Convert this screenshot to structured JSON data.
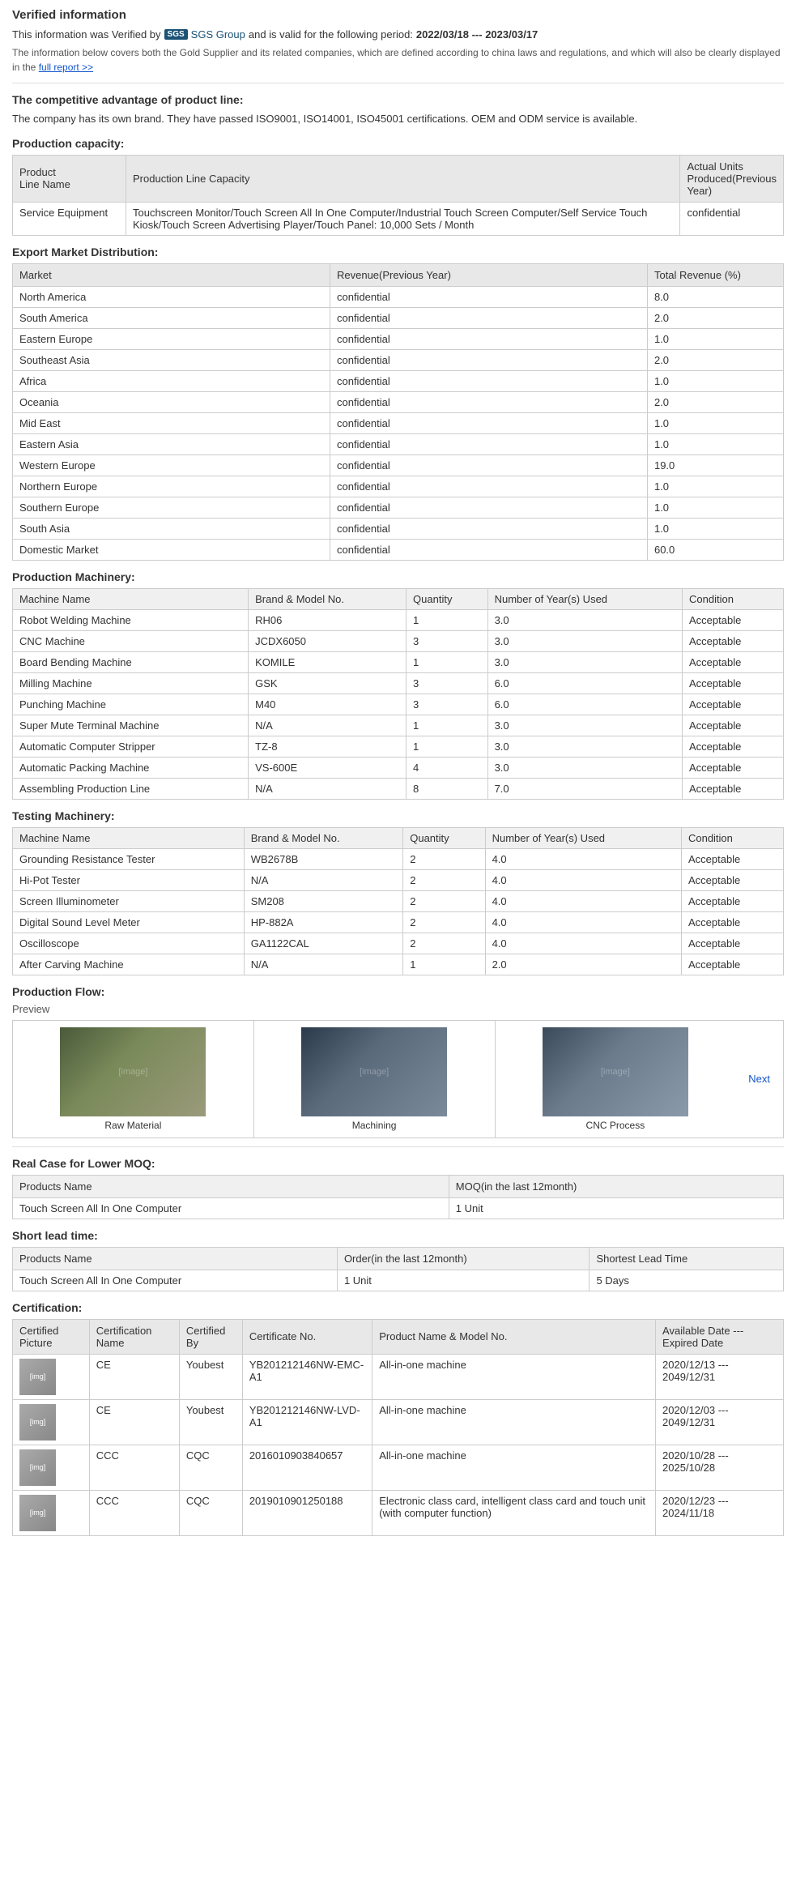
{
  "verified": {
    "title": "Verified information",
    "verified_by_prefix": "This information was Verified by",
    "sgs_badge": "SGS",
    "sgs_link_text": "SGS Group",
    "valid_period_prefix": "and is valid for the following period:",
    "valid_period": "2022/03/18 --- 2023/03/17",
    "note": "The information below covers both the Gold Supplier and its related companies, which are defined according to china laws and regulations, and which will also be clearly displayed in the",
    "full_report_link": "full report >>",
    "competitive_title": "The competitive advantage of product line:",
    "competitive_text": "The company has its own brand. They have passed ISO9001, ISO14001, ISO45001 certifications. OEM and ODM service is available."
  },
  "production_capacity": {
    "title": "Production capacity:",
    "headers": [
      "Product Line Name",
      "Production Line Capacity",
      "Actual Units Produced(Previous Year)"
    ],
    "rows": [
      {
        "line_name": "Service Equipment",
        "capacity": "Touchscreen Monitor/Touch Screen All In One Computer/Industrial Touch Screen Computer/Self Service Touch Kiosk/Touch Screen Advertising Player/Touch Panel: 10,000 Sets / Month",
        "actual_units": "confidential"
      }
    ]
  },
  "export_market": {
    "title": "Export Market Distribution:",
    "headers": [
      "Market",
      "Revenue(Previous Year)",
      "Total Revenue (%)"
    ],
    "rows": [
      {
        "market": "North America",
        "revenue": "confidential",
        "total_revenue": "8.0"
      },
      {
        "market": "South America",
        "revenue": "confidential",
        "total_revenue": "2.0"
      },
      {
        "market": "Eastern Europe",
        "revenue": "confidential",
        "total_revenue": "1.0"
      },
      {
        "market": "Southeast Asia",
        "revenue": "confidential",
        "total_revenue": "2.0"
      },
      {
        "market": "Africa",
        "revenue": "confidential",
        "total_revenue": "1.0"
      },
      {
        "market": "Oceania",
        "revenue": "confidential",
        "total_revenue": "2.0"
      },
      {
        "market": "Mid East",
        "revenue": "confidential",
        "total_revenue": "1.0"
      },
      {
        "market": "Eastern Asia",
        "revenue": "confidential",
        "total_revenue": "1.0"
      },
      {
        "market": "Western Europe",
        "revenue": "confidential",
        "total_revenue": "19.0"
      },
      {
        "market": "Northern Europe",
        "revenue": "confidential",
        "total_revenue": "1.0"
      },
      {
        "market": "Southern Europe",
        "revenue": "confidential",
        "total_revenue": "1.0"
      },
      {
        "market": "South Asia",
        "revenue": "confidential",
        "total_revenue": "1.0"
      },
      {
        "market": "Domestic Market",
        "revenue": "confidential",
        "total_revenue": "60.0"
      }
    ]
  },
  "production_machinery": {
    "title": "Production Machinery:",
    "headers": [
      "Machine Name",
      "Brand & Model No.",
      "Quantity",
      "Number of Year(s) Used",
      "Condition"
    ],
    "rows": [
      {
        "name": "Robot Welding Machine",
        "brand": "RH06",
        "qty": "1",
        "years": "3.0",
        "condition": "Acceptable"
      },
      {
        "name": "CNC Machine",
        "brand": "JCDX6050",
        "qty": "3",
        "years": "3.0",
        "condition": "Acceptable"
      },
      {
        "name": "Board Bending Machine",
        "brand": "KOMILE",
        "qty": "1",
        "years": "3.0",
        "condition": "Acceptable"
      },
      {
        "name": "Milling Machine",
        "brand": "GSK",
        "qty": "3",
        "years": "6.0",
        "condition": "Acceptable"
      },
      {
        "name": "Punching Machine",
        "brand": "M40",
        "qty": "3",
        "years": "6.0",
        "condition": "Acceptable"
      },
      {
        "name": "Super Mute Terminal Machine",
        "brand": "N/A",
        "qty": "1",
        "years": "3.0",
        "condition": "Acceptable"
      },
      {
        "name": "Automatic Computer Stripper",
        "brand": "TZ-8",
        "qty": "1",
        "years": "3.0",
        "condition": "Acceptable"
      },
      {
        "name": "Automatic Packing Machine",
        "brand": "VS-600E",
        "qty": "4",
        "years": "3.0",
        "condition": "Acceptable"
      },
      {
        "name": "Assembling Production Line",
        "brand": "N/A",
        "qty": "8",
        "years": "7.0",
        "condition": "Acceptable"
      }
    ]
  },
  "testing_machinery": {
    "title": "Testing Machinery:",
    "headers": [
      "Machine Name",
      "Brand & Model No.",
      "Quantity",
      "Number of Year(s) Used",
      "Condition"
    ],
    "rows": [
      {
        "name": "Grounding Resistance Tester",
        "brand": "WB2678B",
        "qty": "2",
        "years": "4.0",
        "condition": "Acceptable"
      },
      {
        "name": "Hi-Pot Tester",
        "brand": "N/A",
        "qty": "2",
        "years": "4.0",
        "condition": "Acceptable"
      },
      {
        "name": "Screen Illuminometer",
        "brand": "SM208",
        "qty": "2",
        "years": "4.0",
        "condition": "Acceptable"
      },
      {
        "name": "Digital Sound Level Meter",
        "brand": "HP-882A",
        "qty": "2",
        "years": "4.0",
        "condition": "Acceptable"
      },
      {
        "name": "Oscilloscope",
        "brand": "GA1122CAL",
        "qty": "2",
        "years": "4.0",
        "condition": "Acceptable"
      },
      {
        "name": "After Carving Machine",
        "brand": "N/A",
        "qty": "1",
        "years": "2.0",
        "condition": "Acceptable"
      }
    ]
  },
  "production_flow": {
    "title": "Production Flow:",
    "preview_label": "Preview",
    "next_label": "Next",
    "images": [
      {
        "caption": "Raw Material",
        "color1": "#5a6a4a",
        "color2": "#8a9a7a"
      },
      {
        "caption": "Machining",
        "color1": "#3a4a5a",
        "color2": "#6a7a8a"
      },
      {
        "caption": "CNC Process",
        "color1": "#4a5a6a",
        "color2": "#7a8a9a"
      }
    ]
  },
  "real_case": {
    "title": "Real Case for Lower MOQ:",
    "headers": [
      "Products Name",
      "MOQ(in the last 12month)"
    ],
    "rows": [
      {
        "product": "Touch Screen All In One Computer",
        "moq": "1 Unit"
      }
    ]
  },
  "short_lead_time": {
    "title": "Short lead time:",
    "headers": [
      "Products Name",
      "Order(in the last 12month)",
      "Shortest Lead Time"
    ],
    "rows": [
      {
        "product": "Touch Screen All In One Computer",
        "order": "1 Unit",
        "lead_time": "5 Days"
      }
    ]
  },
  "certification": {
    "title": "Certification:",
    "headers": [
      "Certified Picture",
      "Certification Name",
      "Certified By",
      "Certificate No.",
      "Product Name & Model No.",
      "Available Date --- Expired Date"
    ],
    "rows": [
      {
        "cert_name": "CE",
        "certified_by": "Youbest",
        "cert_no": "YB201212146NW-EMC-A1",
        "product_model": "All-in-one machine",
        "date_range": "2020/12/13 --- 2049/12/31"
      },
      {
        "cert_name": "CE",
        "certified_by": "Youbest",
        "cert_no": "YB201212146NW-LVD-A1",
        "product_model": "All-in-one machine",
        "date_range": "2020/12/03 --- 2049/12/31"
      },
      {
        "cert_name": "CCC",
        "certified_by": "CQC",
        "cert_no": "2016010903840657",
        "product_model": "All-in-one machine",
        "date_range": "2020/10/28 --- 2025/10/28"
      },
      {
        "cert_name": "CCC",
        "certified_by": "CQC",
        "cert_no": "2019010901250188",
        "product_model": "Electronic class card, intelligent class card and touch unit (with computer function)",
        "date_range": "2020/12/23 --- 2024/11/18"
      }
    ]
  }
}
